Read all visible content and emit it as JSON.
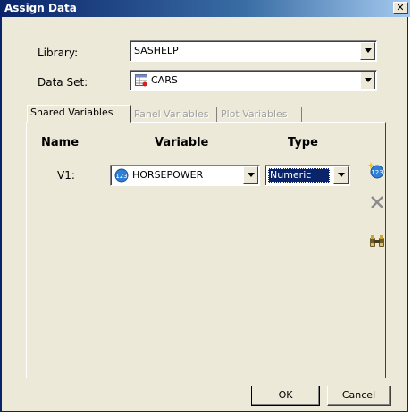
{
  "window": {
    "title": "Assign Data",
    "close_glyph": "✕"
  },
  "library": {
    "label": "Library:",
    "value": "SASHELP"
  },
  "dataset": {
    "label": "Data Set:",
    "value": "CARS",
    "icon": "table-icon"
  },
  "tabs": [
    {
      "label": "Shared Variables",
      "active": true
    },
    {
      "label": "Panel Variables",
      "active": false
    },
    {
      "label": "Plot Variables",
      "active": false
    }
  ],
  "columns": {
    "name": "Name",
    "variable": "Variable",
    "type": "Type"
  },
  "rows": [
    {
      "name": "V1:",
      "variable": "HORSEPOWER",
      "variable_icon": "numeric-variable-icon",
      "type": "Numeric"
    }
  ],
  "side_tools": [
    {
      "icon": "add-variable-icon"
    },
    {
      "icon": "delete-icon"
    },
    {
      "icon": "binoculars-icon"
    }
  ],
  "buttons": {
    "ok": "OK",
    "cancel": "Cancel"
  },
  "colors": {
    "title_bar": "#0a246a",
    "selection": "#0a246a",
    "face": "#ece9d8"
  }
}
